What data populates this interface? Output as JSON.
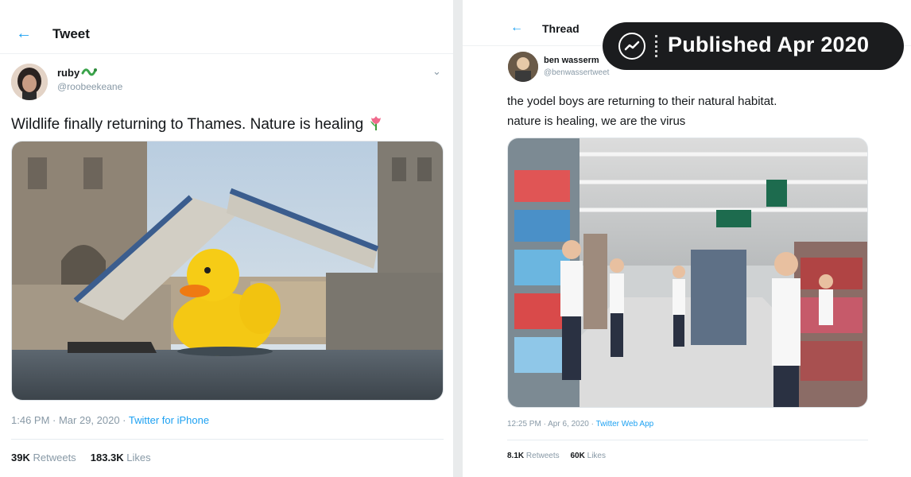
{
  "left": {
    "header": {
      "title": "Tweet"
    },
    "tweet": {
      "name": "ruby",
      "handle": "@roobeekeane",
      "text": "Wildlife finally returning to Thames. Nature is healing",
      "time": "1:46 PM · Mar 29, 2020 ·",
      "source": "Twitter for iPhone",
      "retweets": "39K",
      "retweets_label": "Retweets",
      "likes": "183.3K",
      "likes_label": "Likes"
    }
  },
  "right": {
    "header": {
      "title": "Thread"
    },
    "tweet": {
      "name": "ben wasserm",
      "handle": "@benwassertweet",
      "text_line1": "the yodel boys are returning to their natural habitat.",
      "text_line2": "nature is healing, we are the virus",
      "time": "12:25 PM · Apr 6, 2020 ·",
      "source": "Twitter Web App",
      "retweets": "8.1K",
      "retweets_label": "Retweets",
      "likes": "60K",
      "likes_label": "Likes"
    }
  },
  "badge": {
    "text": "Published Apr 2020"
  },
  "icons": [
    "back-arrow-icon",
    "verified-snake-emoji-icon",
    "chevron-down-icon",
    "tulip-emoji-icon",
    "trend-line-icon"
  ],
  "colors": {
    "accent": "#1da1f2",
    "muted": "#8899a6",
    "badge_bg": "#1b1c1e"
  }
}
